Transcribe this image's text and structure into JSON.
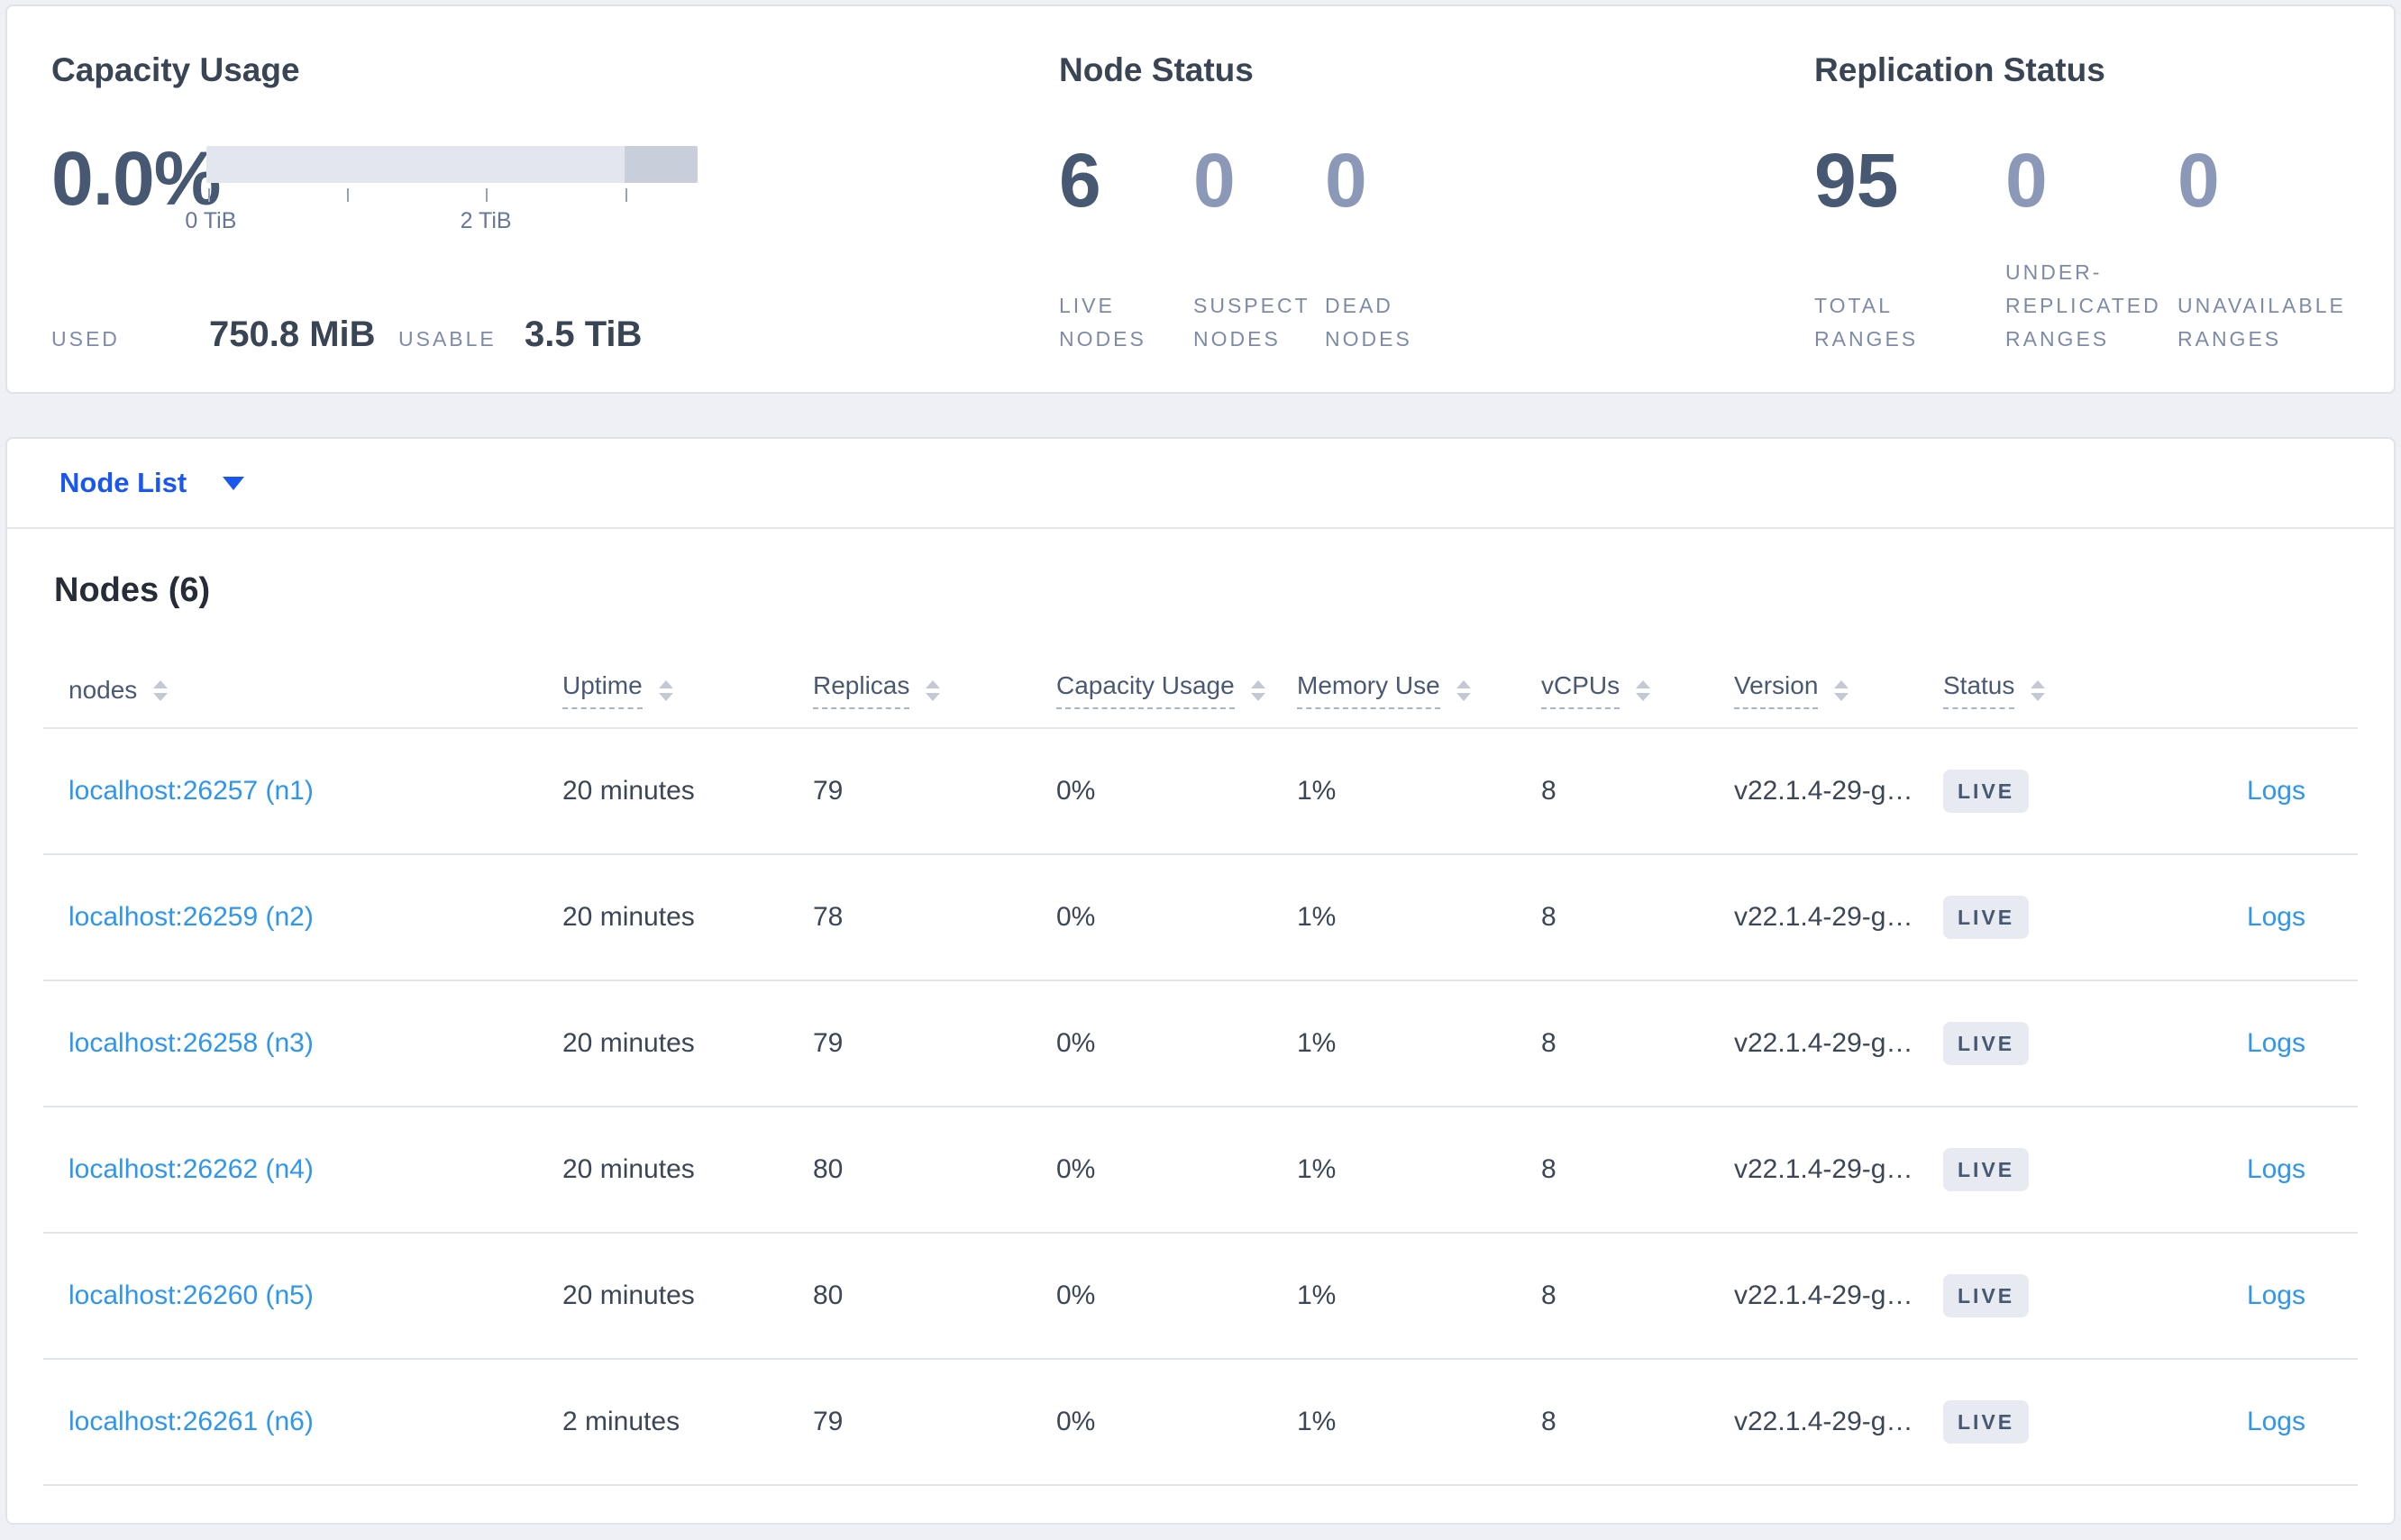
{
  "summary": {
    "capacity": {
      "title": "Capacity Usage",
      "percent": "0.0%",
      "tick_labels": [
        "0 TiB",
        "2 TiB"
      ],
      "used_label": "USED",
      "used_value": "750.8 MiB",
      "usable_label": "USABLE",
      "usable_value": "3.5 TiB"
    },
    "node_status": {
      "title": "Node Status",
      "stats": [
        {
          "value": "6",
          "label": "LIVE NODES"
        },
        {
          "value": "0",
          "label": "SUSPECT NODES"
        },
        {
          "value": "0",
          "label": "DEAD NODES"
        }
      ]
    },
    "replication": {
      "title": "Replication Status",
      "stats": [
        {
          "value": "95",
          "label": "TOTAL RANGES"
        },
        {
          "value": "0",
          "label": "UNDER-REPLICATED RANGES"
        },
        {
          "value": "0",
          "label": "UNAVAILABLE RANGES"
        }
      ]
    }
  },
  "node_list": {
    "dropdown_label": "Node List",
    "heading": "Nodes (6)",
    "columns": [
      "nodes",
      "Uptime",
      "Replicas",
      "Capacity Usage",
      "Memory Use",
      "vCPUs",
      "Version",
      "Status"
    ],
    "logs_label": "Logs",
    "rows": [
      {
        "node": "localhost:26257 (n1)",
        "uptime": "20 minutes",
        "replicas": "79",
        "capacity": "0%",
        "memory": "1%",
        "vcpus": "8",
        "version": "v22.1.4-29-g…",
        "status": "LIVE"
      },
      {
        "node": "localhost:26259 (n2)",
        "uptime": "20 minutes",
        "replicas": "78",
        "capacity": "0%",
        "memory": "1%",
        "vcpus": "8",
        "version": "v22.1.4-29-g…",
        "status": "LIVE"
      },
      {
        "node": "localhost:26258 (n3)",
        "uptime": "20 minutes",
        "replicas": "79",
        "capacity": "0%",
        "memory": "1%",
        "vcpus": "8",
        "version": "v22.1.4-29-g…",
        "status": "LIVE"
      },
      {
        "node": "localhost:26262 (n4)",
        "uptime": "20 minutes",
        "replicas": "80",
        "capacity": "0%",
        "memory": "1%",
        "vcpus": "8",
        "version": "v22.1.4-29-g…",
        "status": "LIVE"
      },
      {
        "node": "localhost:26260 (n5)",
        "uptime": "20 minutes",
        "replicas": "80",
        "capacity": "0%",
        "memory": "1%",
        "vcpus": "8",
        "version": "v22.1.4-29-g…",
        "status": "LIVE"
      },
      {
        "node": "localhost:26261 (n6)",
        "uptime": "2 minutes",
        "replicas": "79",
        "capacity": "0%",
        "memory": "1%",
        "vcpus": "8",
        "version": "v22.1.4-29-g…",
        "status": "LIVE"
      }
    ]
  },
  "colors": {
    "nav_blue": "#1a56f0",
    "link_blue": "#2d96f0",
    "dark_slate": "#394455",
    "stat_emphasis": "#475872",
    "stat_muted": "#8b98b8",
    "label_gray": "#7e8aa8",
    "badge_bg": "#e7eaf1",
    "bar_track": "#e3e6ee",
    "bar_overflow": "#c9cedb",
    "page_bg": "#eef0f6"
  }
}
